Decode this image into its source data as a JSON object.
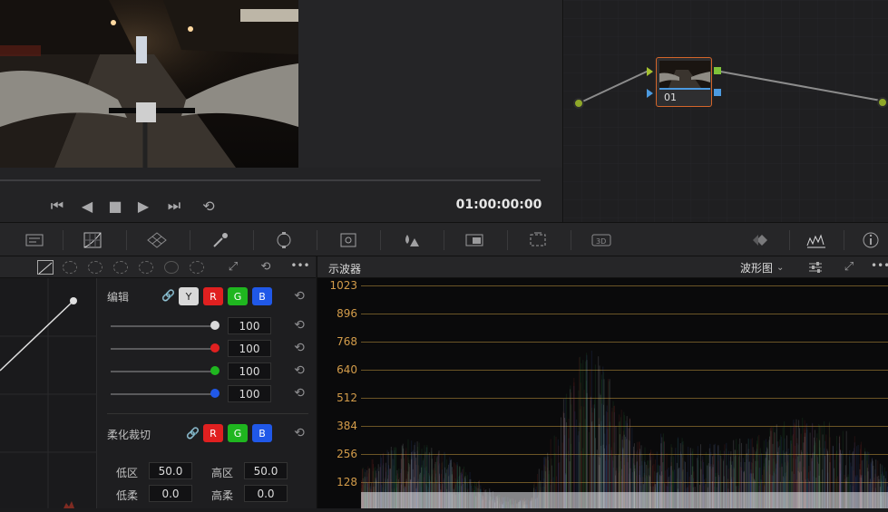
{
  "viewer": {
    "timecode": "01:00:00:00",
    "transport": {
      "first": "⏮",
      "reverse": "◀",
      "stop": "■",
      "play": "▶",
      "last": "⏭",
      "loop": "⟲"
    }
  },
  "node_editor": {
    "node_label": "01"
  },
  "toolbar": {
    "tools": [
      "camera-raw",
      "curves-grid",
      "color-warper",
      "eyedropper",
      "power-window",
      "tracker",
      "blur",
      "key",
      "sizing",
      "3d",
      "keyframes",
      "scopes",
      "info"
    ]
  },
  "curves": {
    "header_icons": [
      "curve",
      "hue-vs-hue",
      "hue-vs-sat",
      "hue-vs-lum",
      "lum-vs-sat",
      "sat-vs-sat",
      "sat-vs-lum"
    ]
  },
  "edit": {
    "title": "编辑",
    "chips": {
      "y": "Y",
      "r": "R",
      "g": "G",
      "b": "B"
    },
    "values": [
      "100",
      "100",
      "100",
      "100"
    ],
    "colors": {
      "y": "#d9d9d9",
      "r": "#e02020",
      "g": "#1fb61f",
      "b": "#2058e8"
    }
  },
  "soft_clip": {
    "title": "柔化裁切",
    "chips": {
      "r": "R",
      "g": "G",
      "b": "B"
    },
    "low_label": "低区",
    "low_value": "50.0",
    "high_label": "高区",
    "high_value": "50.0",
    "low_soft_label": "低柔",
    "low_soft_value": "0.0",
    "high_soft_label": "高柔",
    "high_soft_value": "0.0"
  },
  "scope": {
    "title": "示波器",
    "mode": "波形图",
    "ticks": [
      "1023",
      "896",
      "768",
      "640",
      "512",
      "384",
      "256",
      "128"
    ],
    "accent": "#d39c4a"
  }
}
